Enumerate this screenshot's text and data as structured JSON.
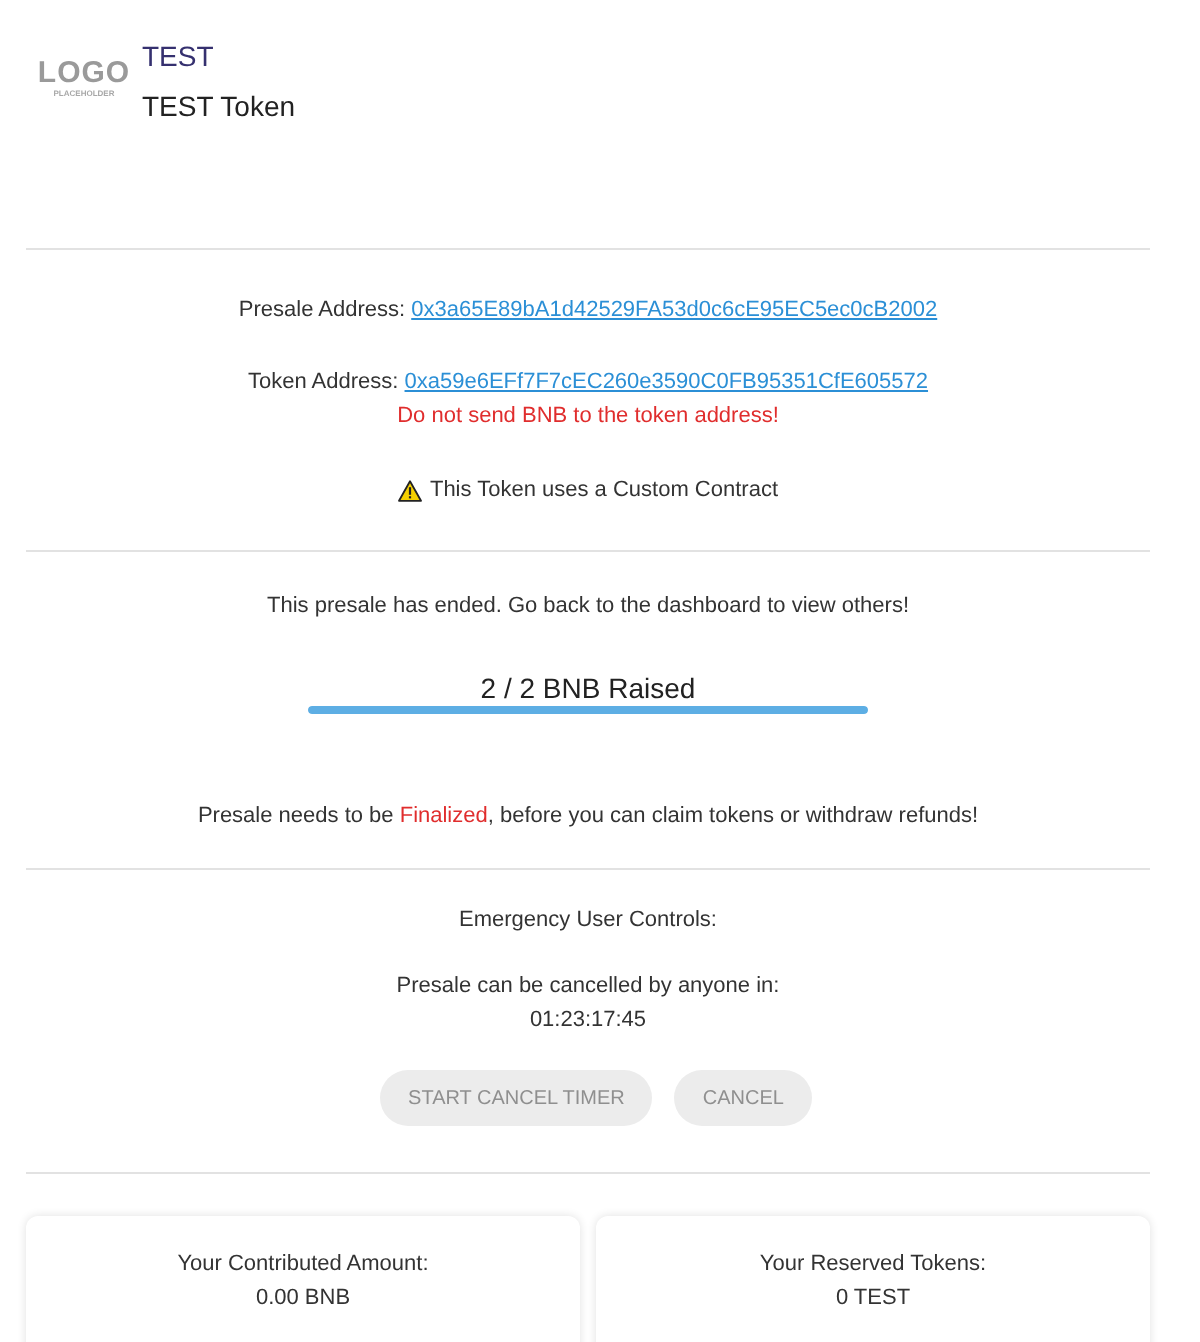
{
  "header": {
    "logo": {
      "text": "LOGO",
      "subtext": "PLACEHOLDER"
    },
    "symbol": "TEST",
    "name": "TEST Token"
  },
  "addresses": [
    {
      "label": "Presale Address:",
      "address": "0x3a65E89bA1d42529FA53d0c6cE95EC5ec0cB2002"
    },
    {
      "label": "Token Address:",
      "address": "0xa59e6EFf7F7cEC260e3590C0FB95351CfE605572",
      "warning": "Do not send BNB to the token address!"
    }
  ],
  "custom_contract_notice": "This Token uses a Custom Contract",
  "status": {
    "message": "This presale has ended. Go back to the dashboard to view others!",
    "raised": "2 / 2 BNB Raised",
    "level": 1
  },
  "finalize_notice": {
    "parts": [
      {
        "kind": "plain",
        "text": "Presale needs to be "
      },
      {
        "kind": "alert",
        "text": "Finalized"
      },
      {
        "kind": "plain",
        "text": ", before you can claim tokens or withdraw refunds!"
      }
    ]
  },
  "emergency": {
    "title": "Emergency User Controls:",
    "countdown_label": "Presale can be cancelled by anyone in:",
    "countdown": "01:23:17:45",
    "buttons": [
      {
        "label": "START CANCEL TIMER",
        "disabled": true
      },
      {
        "label": "CANCEL",
        "disabled": true
      }
    ]
  },
  "cards": [
    {
      "title": "Your Contributed Amount:",
      "value": "0.00 BNB"
    },
    {
      "title": "Your Reserved Tokens:",
      "value": "0 TEST"
    }
  ]
}
